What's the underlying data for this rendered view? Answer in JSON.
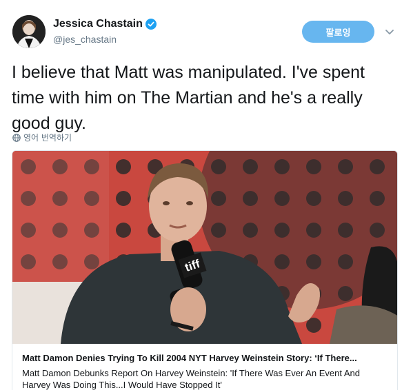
{
  "author": {
    "display_name": "Jessica Chastain",
    "handle": "@jes_chastain",
    "verified": true
  },
  "follow_label": "팔로잉",
  "tweet_text": "I believe that Matt was manipulated. I've spent time with him on The Martian and he's a really good guy.",
  "translate_label": "영어 번역하기",
  "card": {
    "title": "Matt Damon Denies Trying To Kill 2004 NYT Harvey Weinstein Story: ‘If There...",
    "description": "Matt Damon Debunks Report On Harvey Weinstein: 'If There Was Ever An Event And Harvey Was Doing This...I Would Have Stopped It'",
    "image_logo_text": "tiff"
  },
  "colors": {
    "accent": "#67b6ef",
    "verified": "#1da1f2",
    "muted": "#657786",
    "backdrop_red": "#c9483f"
  }
}
